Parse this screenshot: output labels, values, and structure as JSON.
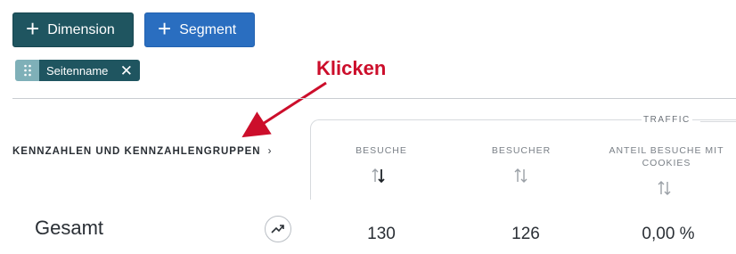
{
  "toolbar": {
    "dimension_button": {
      "icon": "plus-icon",
      "label": "Dimension"
    },
    "segment_button": {
      "icon": "plus-icon",
      "label": "Segment"
    }
  },
  "filter_chip": {
    "handle_icon": "drag-handle-icon",
    "label": "Seitenname",
    "remove_icon": "close-icon"
  },
  "annotation": {
    "text": "Klicken",
    "color": "#cc0e2b"
  },
  "metrics_link": {
    "label": "KENNZAHLEN UND KENNZAHLENGRUPPEN",
    "chevron": "›"
  },
  "group_header": "TRAFFIC",
  "columns": [
    {
      "label": "BESUCHE",
      "sort_icon": "sort-arrows-icon",
      "sorted": "descending"
    },
    {
      "label": "BESUCHER",
      "sort_icon": "sort-arrows-icon",
      "sorted": "none"
    },
    {
      "label": "ANTEIL BESUCHE MIT COOKIES",
      "sort_icon": "sort-arrows-icon",
      "sorted": "none"
    }
  ],
  "total_row": {
    "label": "Gesamt",
    "trend_icon": "trend-up-icon",
    "values": [
      "130",
      "126",
      "0,00 %"
    ]
  },
  "colors": {
    "dimension_button": "#1f5560",
    "segment_button": "#2a6ec0",
    "chip_handle": "#7fb0b8"
  }
}
